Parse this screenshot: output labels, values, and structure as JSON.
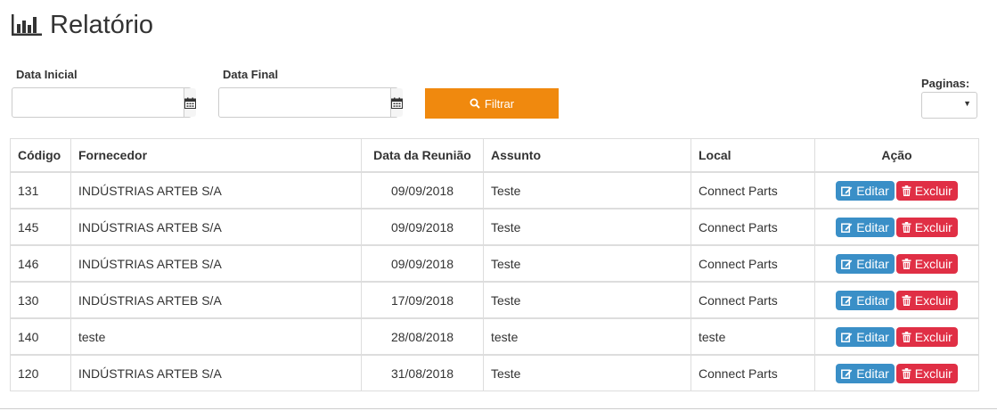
{
  "header": {
    "title": "Relatório",
    "icon": "bar-chart-icon"
  },
  "filters": {
    "start_date_label": "Data Inicial",
    "start_date_value": "",
    "end_date_label": "Data Final",
    "end_date_value": "",
    "calendar_icon": "calendar-icon",
    "filter_button": "Filtrar",
    "filter_icon": "search-icon",
    "pages_label": "Paginas:",
    "pages_value": ""
  },
  "table": {
    "columns": [
      "Código",
      "Fornecedor",
      "Data da Reunião",
      "Assunto",
      "Local",
      "Ação"
    ],
    "rows": [
      [
        "131",
        "INDÚSTRIAS ARTEB S/A",
        "09/09/2018",
        "Teste",
        "Connect Parts"
      ],
      [
        "145",
        "INDÚSTRIAS ARTEB S/A",
        "09/09/2018",
        "Teste",
        "Connect Parts"
      ],
      [
        "146",
        "INDÚSTRIAS ARTEB S/A",
        "09/09/2018",
        "Teste",
        "Connect Parts"
      ],
      [
        "130",
        "INDÚSTRIAS ARTEB S/A",
        "17/09/2018",
        "Teste",
        "Connect Parts"
      ],
      [
        "140",
        "teste",
        "28/08/2018",
        "teste",
        "teste"
      ],
      [
        "120",
        "INDÚSTRIAS ARTEB S/A",
        "31/08/2018",
        "Teste",
        "Connect Parts"
      ]
    ],
    "edit_label": "Editar",
    "delete_label": "Excluir",
    "edit_icon": "edit-icon",
    "delete_icon": "trash-icon"
  },
  "colors": {
    "filter_button": "#f0890e",
    "edit_button": "#3a8fc7",
    "delete_button": "#e02f45"
  }
}
